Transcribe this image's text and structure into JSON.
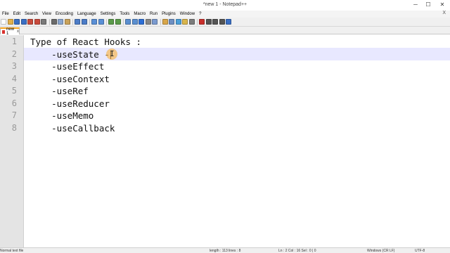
{
  "window": {
    "title": "*new 1 - Notepad++",
    "min_glyph": "─",
    "max_glyph": "☐",
    "close_glyph": "✕"
  },
  "menu": {
    "items": [
      "File",
      "Edit",
      "Search",
      "View",
      "Encoding",
      "Language",
      "Settings",
      "Tools",
      "Macro",
      "Run",
      "Plugins",
      "Window",
      "?"
    ],
    "close_glyph": "X"
  },
  "toolbar": {
    "icons": [
      {
        "name": "new-file-icon",
        "color": "#ffffff"
      },
      {
        "name": "open-file-icon",
        "color": "#e3b14a"
      },
      {
        "name": "save-icon",
        "color": "#3a6fc4"
      },
      {
        "name": "save-all-icon",
        "color": "#3a6fc4"
      },
      {
        "name": "close-icon",
        "color": "#c94a3c"
      },
      {
        "name": "close-all-icon",
        "color": "#c94a3c"
      },
      {
        "name": "print-icon",
        "color": "#7a7a7a"
      },
      {
        "name": "separator",
        "color": ""
      },
      {
        "name": "cut-icon",
        "color": "#6b6b6b"
      },
      {
        "name": "copy-icon",
        "color": "#8aa6cf"
      },
      {
        "name": "paste-icon",
        "color": "#c9a25a"
      },
      {
        "name": "separator",
        "color": ""
      },
      {
        "name": "undo-icon",
        "color": "#4c7cc7"
      },
      {
        "name": "redo-icon",
        "color": "#4c7cc7"
      },
      {
        "name": "separator",
        "color": ""
      },
      {
        "name": "find-icon",
        "color": "#5a8fd6"
      },
      {
        "name": "replace-icon",
        "color": "#5a8fd6"
      },
      {
        "name": "separator",
        "color": ""
      },
      {
        "name": "zoom-in-icon",
        "color": "#5b9b4a"
      },
      {
        "name": "zoom-out-icon",
        "color": "#5b9b4a"
      },
      {
        "name": "separator",
        "color": ""
      },
      {
        "name": "sync-vertical-icon",
        "color": "#5b8fd0"
      },
      {
        "name": "sync-horizontal-icon",
        "color": "#5b8fd0"
      },
      {
        "name": "word-wrap-icon",
        "color": "#2d6fd6"
      },
      {
        "name": "show-all-chars-icon",
        "color": "#888888"
      },
      {
        "name": "indent-guide-icon",
        "color": "#7a9acf"
      },
      {
        "name": "separator",
        "color": ""
      },
      {
        "name": "lang-icon",
        "color": "#d8a64a"
      },
      {
        "name": "doc-map-icon",
        "color": "#6e8fc2"
      },
      {
        "name": "function-list-icon",
        "color": "#4b9fd8"
      },
      {
        "name": "folder-as-workspace-icon",
        "color": "#d9b54c"
      },
      {
        "name": "monitoring-icon",
        "color": "#7c7c7c"
      },
      {
        "name": "separator",
        "color": ""
      },
      {
        "name": "record-macro-icon",
        "color": "#c9302c"
      },
      {
        "name": "stop-record-icon",
        "color": "#555555"
      },
      {
        "name": "play-macro-icon",
        "color": "#555555"
      },
      {
        "name": "run-macro-multiple-icon",
        "color": "#555555"
      },
      {
        "name": "save-macro-icon",
        "color": "#3a6fc4"
      }
    ]
  },
  "tab": {
    "label": "new 1",
    "close_glyph": "x"
  },
  "editor": {
    "lines": [
      {
        "num": "1",
        "text": "Type of React Hooks :"
      },
      {
        "num": "2",
        "text": "    -useState"
      },
      {
        "num": "3",
        "text": "    -useEffect"
      },
      {
        "num": "4",
        "text": "    -useContext"
      },
      {
        "num": "5",
        "text": "    -useRef"
      },
      {
        "num": "6",
        "text": "    -useReducer"
      },
      {
        "num": "7",
        "text": "    -useMemo"
      },
      {
        "num": "8",
        "text": "    -useCallback"
      }
    ],
    "current_line": 2,
    "current_line_suffix": " -",
    "ibeam_glyph": "I"
  },
  "status": {
    "file_type": "Normal text file",
    "length": "length : 113    lines : 8",
    "position": "Ln : 2    Col : 16    Sel : 0 | 0",
    "eol": "Windows (CR LF)",
    "encoding": "UTF-8"
  }
}
